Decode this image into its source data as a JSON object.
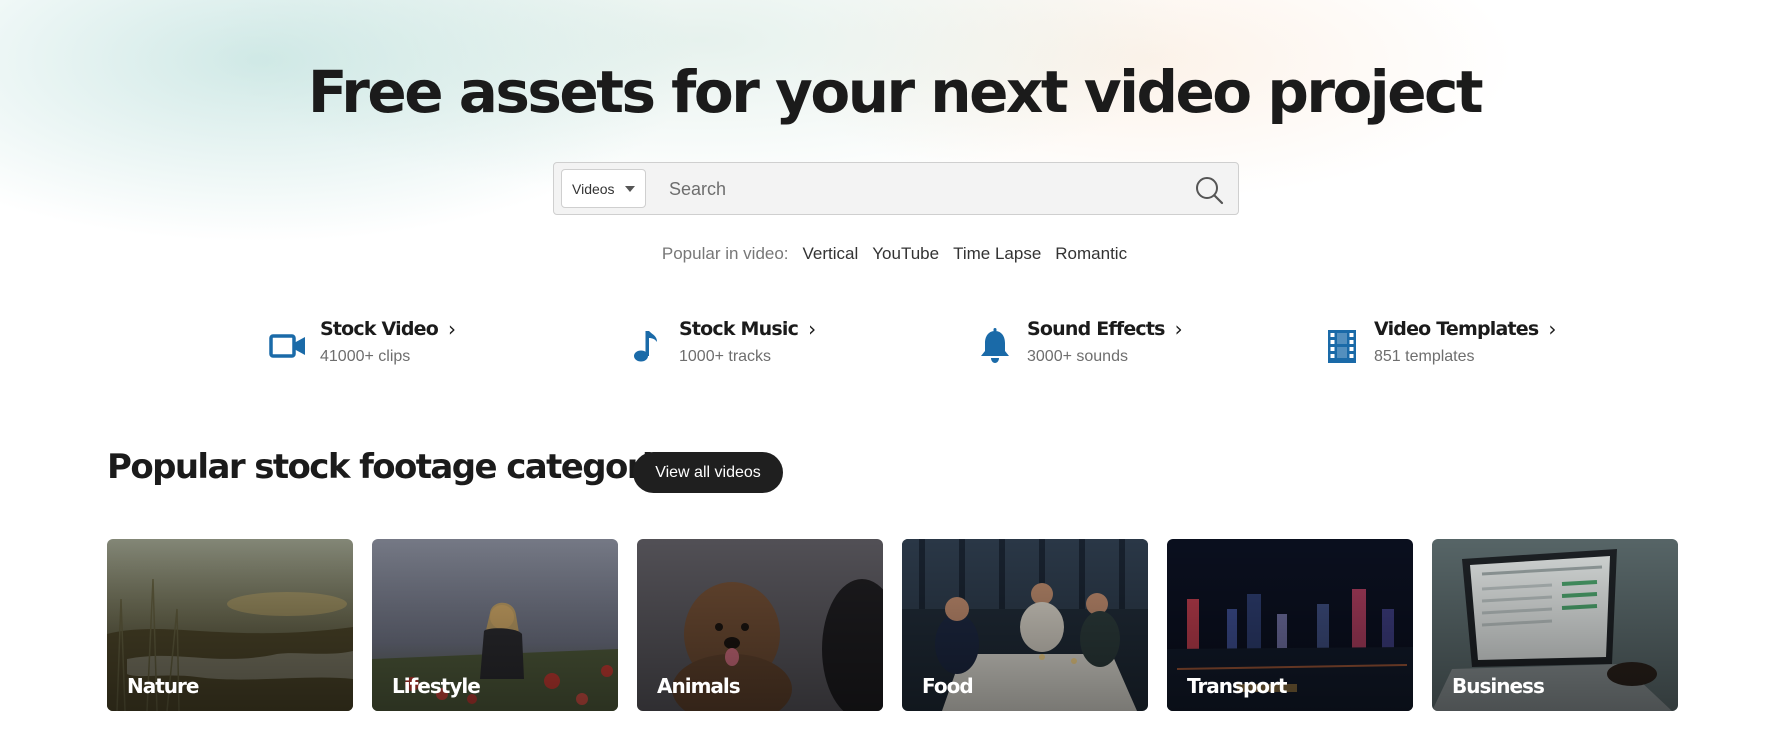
{
  "hero": {
    "title": "Free assets for your next video project"
  },
  "search": {
    "type_selected": "Videos",
    "placeholder": "Search"
  },
  "popular": {
    "label": "Popular in video:",
    "links": [
      "Vertical",
      "YouTube",
      "Time Lapse",
      "Romantic"
    ]
  },
  "assets": [
    {
      "title": "Stock Video",
      "subtitle": "41000+ clips",
      "icon": "video-camera-icon"
    },
    {
      "title": "Stock Music",
      "subtitle": "1000+ tracks",
      "icon": "music-note-icon"
    },
    {
      "title": "Sound Effects",
      "subtitle": "3000+ sounds",
      "icon": "bell-icon"
    },
    {
      "title": "Video Templates",
      "subtitle": "851 templates",
      "icon": "film-strip-icon"
    }
  ],
  "categories_section": {
    "title": "Popular stock footage categories",
    "view_all_label": "View all videos"
  },
  "categories": [
    {
      "label": "Nature"
    },
    {
      "label": "Lifestyle"
    },
    {
      "label": "Animals"
    },
    {
      "label": "Food"
    },
    {
      "label": "Transport"
    },
    {
      "label": "Business"
    }
  ],
  "colors": {
    "accent_blue": "#1a6aa8",
    "button_dark": "#1f1f1f",
    "title_text": "#1b1b1b"
  }
}
